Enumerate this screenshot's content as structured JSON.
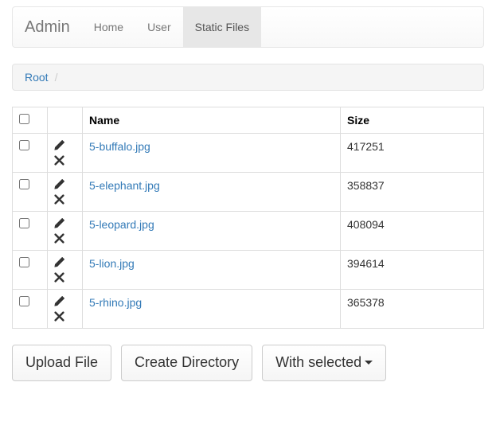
{
  "navbar": {
    "brand": "Admin",
    "items": [
      {
        "label": "Home",
        "active": false
      },
      {
        "label": "User",
        "active": false
      },
      {
        "label": "Static Files",
        "active": true
      }
    ]
  },
  "breadcrumb": {
    "items": [
      {
        "label": "Root"
      }
    ],
    "sep": "/"
  },
  "table": {
    "columns": {
      "name": "Name",
      "size": "Size"
    },
    "rows": [
      {
        "name": "5-buffalo.jpg",
        "size": "417251"
      },
      {
        "name": "5-elephant.jpg",
        "size": "358837"
      },
      {
        "name": "5-leopard.jpg",
        "size": "408094"
      },
      {
        "name": "5-lion.jpg",
        "size": "394614"
      },
      {
        "name": "5-rhino.jpg",
        "size": "365378"
      }
    ]
  },
  "buttons": {
    "upload": "Upload File",
    "create_dir": "Create Directory",
    "with_selected": "With selected"
  },
  "icons": {
    "edit": "pencil-icon",
    "delete": "x-icon"
  }
}
